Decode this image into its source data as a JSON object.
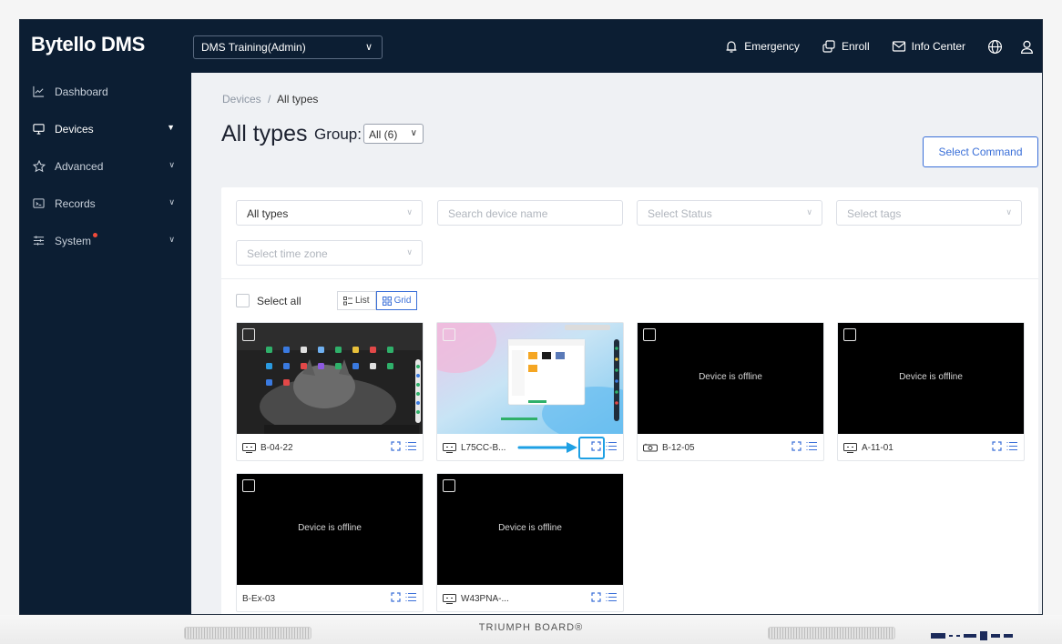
{
  "app": {
    "logo": "Bytello DMS",
    "org": "DMS Training(Admin)"
  },
  "header": {
    "emergency": "Emergency",
    "enroll": "Enroll",
    "info_center": "Info Center"
  },
  "sidebar": {
    "items": [
      {
        "label": "Dashboard",
        "icon": "chart-line-icon"
      },
      {
        "label": "Devices",
        "icon": "monitor-icon"
      },
      {
        "label": "Advanced",
        "icon": "star-icon"
      },
      {
        "label": "Records",
        "icon": "records-icon"
      },
      {
        "label": "System",
        "icon": "sliders-icon"
      }
    ]
  },
  "breadcrumb": {
    "parent": "Devices",
    "separator": "/",
    "current": "All types"
  },
  "page": {
    "title": "All types",
    "group_label": "Group:",
    "group_value": "All (6)",
    "select_command": "Select Command"
  },
  "filters": {
    "type_value": "All types",
    "search_placeholder": "Search device name",
    "status_placeholder": "Select Status",
    "tags_placeholder": "Select tags",
    "timezone_placeholder": "Select time zone"
  },
  "toolbar": {
    "select_all": "Select all",
    "list": "List",
    "grid": "Grid"
  },
  "devices": [
    {
      "name": "B-04-22",
      "status": "online",
      "type": "display"
    },
    {
      "name": "L75CC-B...",
      "status": "online",
      "type": "display"
    },
    {
      "name": "B-12-05",
      "status": "offline",
      "offline_text": "Device is offline",
      "type": "camera"
    },
    {
      "name": "A-11-01",
      "status": "offline",
      "offline_text": "Device is offline",
      "type": "display"
    },
    {
      "name": "B-Ex-03",
      "status": "offline",
      "offline_text": "Device is offline",
      "type": "none"
    },
    {
      "name": "W43PNA-...",
      "status": "offline",
      "offline_text": "Device is offline",
      "type": "display"
    }
  ],
  "bezel": {
    "brand": "TRIUMPH BOARD®"
  },
  "colors": {
    "sidebar": "#0c1e33",
    "accent": "#3a6fd8",
    "annotation": "#1ea0e4"
  }
}
